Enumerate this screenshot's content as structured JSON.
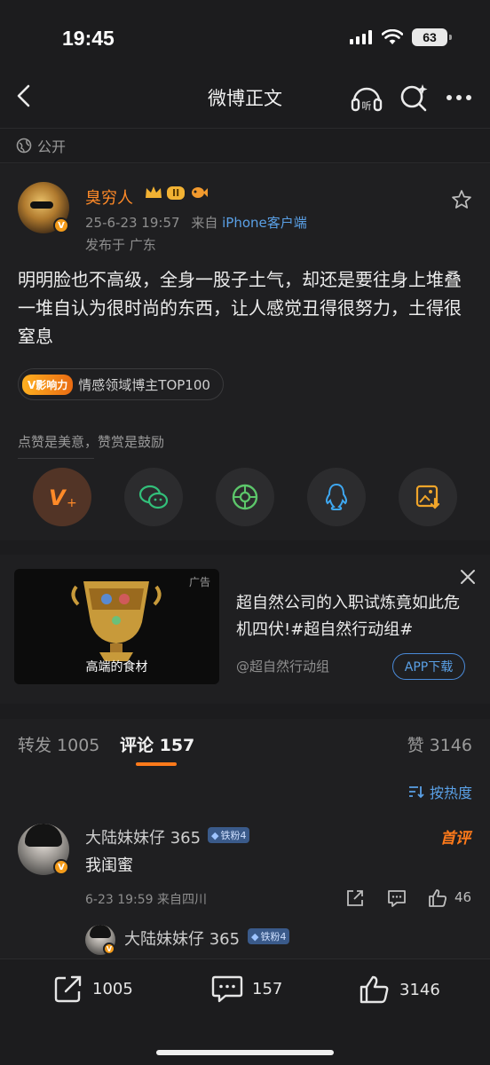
{
  "status": {
    "time": "19:45",
    "battery": "63"
  },
  "nav": {
    "title": "微博正文"
  },
  "visibility": {
    "label": "公开"
  },
  "post": {
    "author": "臭穷人",
    "level_badge": "II",
    "date": "25-6-23 19:57",
    "source_prefix": "来自",
    "source": "iPhone客户端",
    "location": "发布于 广东",
    "text": "明明脸也不高级，全身一股子土气，却还是要往身上堆叠一堆自认为很时尚的东西，让人感觉丑得很努力，土得很窒息",
    "influence_tag": "V影响力",
    "influence_label": "情感领域博主TOP100",
    "like_hint": "点赞是美意，赞赏是鼓励",
    "share_icons": [
      "reward-icon",
      "wechat-icon",
      "moments-icon",
      "qq-icon",
      "save-image-icon"
    ]
  },
  "ad": {
    "tag": "广告",
    "image_caption": "高端的食材",
    "title": "超自然公司的入职试炼竟如此危机四伏!#超自然行动组#",
    "account": "@超自然行动组",
    "cta": "APP下载"
  },
  "tabs": {
    "repost": "转发 1005",
    "comments": "评论 157",
    "likes": "赞 3146",
    "sort": "按热度"
  },
  "comments": [
    {
      "name": "大陆妹妹仔 365",
      "fan_badge": "铁粉4",
      "first_badge": "首评",
      "text": "我闺蜜",
      "meta": "6-23 19:59  来自四川",
      "likes": "46",
      "reply_name": "大陆妹妹仔 365",
      "reply_badge": "铁粉4"
    }
  ],
  "bottom": {
    "reposts": "1005",
    "comments": "157",
    "likes": "3146"
  }
}
